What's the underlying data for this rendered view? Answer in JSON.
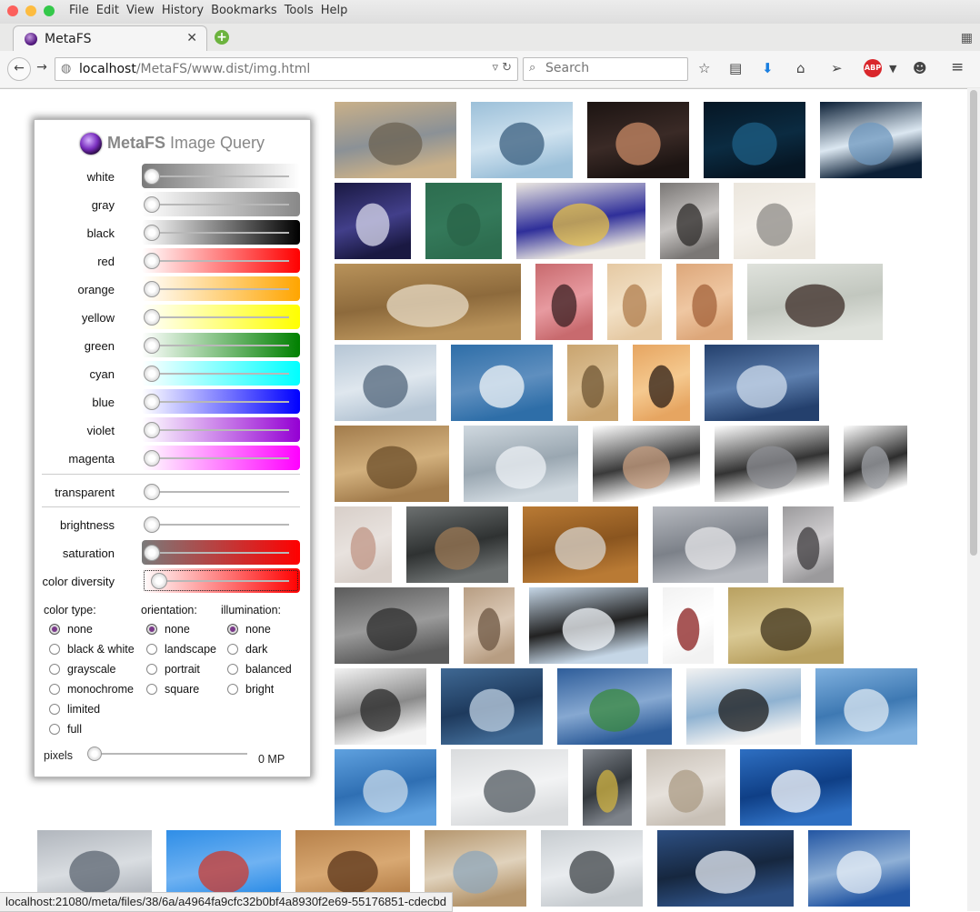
{
  "window": {
    "menu": [
      "File",
      "Edit",
      "View",
      "History",
      "Bookmarks",
      "Tools",
      "Help"
    ]
  },
  "tab": {
    "title": "MetaFS"
  },
  "url": {
    "host": "localhost",
    "path": "/MetaFS/www.dist/img.html"
  },
  "search": {
    "placeholder": "Search"
  },
  "panel": {
    "title_bold": "MetaFS",
    "title_rest": "Image Query",
    "sliders": [
      {
        "label": "white",
        "gradient": "linear-gradient(to left,#ffffff,#7a7a7a)"
      },
      {
        "label": "gray",
        "gradient": "linear-gradient(to right,#ffffff,#888888)"
      },
      {
        "label": "black",
        "gradient": "linear-gradient(to right,#ffffff,#000000)"
      },
      {
        "label": "red",
        "gradient": "linear-gradient(to right,#ffffff,#ff0000)"
      },
      {
        "label": "orange",
        "gradient": "linear-gradient(to right,#ffffff,#ffa500)"
      },
      {
        "label": "yellow",
        "gradient": "linear-gradient(to right,#ffffff,#ffff00)"
      },
      {
        "label": "green",
        "gradient": "linear-gradient(to right,#ffffff,#008000)"
      },
      {
        "label": "cyan",
        "gradient": "linear-gradient(to right,#ffffff,#00ffff)"
      },
      {
        "label": "blue",
        "gradient": "linear-gradient(to right,#ffffff,#0000ff)"
      },
      {
        "label": "violet",
        "gradient": "linear-gradient(to right,#ffffff,#9400d3)"
      },
      {
        "label": "magenta",
        "gradient": "linear-gradient(to right,#ffffff,#ff00ff)"
      }
    ],
    "transparent_label": "transparent",
    "brightness_label": "brightness",
    "saturation_label": "saturation",
    "diversity_label": "color diversity",
    "color_type": {
      "label": "color type:",
      "options": [
        "none",
        "black & white",
        "grayscale",
        "monochrome",
        "limited",
        "full"
      ],
      "selected": "none"
    },
    "orientation": {
      "label": "orientation:",
      "options": [
        "none",
        "landscape",
        "portrait",
        "square"
      ],
      "selected": "none"
    },
    "illumination": {
      "label": "illumination:",
      "options": [
        "none",
        "dark",
        "balanced",
        "bright"
      ],
      "selected": "none"
    },
    "pixels_label": "pixels",
    "pixels_value": "0 MP"
  },
  "thumbnails": [
    {
      "name": "lighthouse",
      "colors": [
        "#c9b089",
        "#6b6152",
        "#8b9196"
      ]
    },
    {
      "name": "misty-forest",
      "colors": [
        "#9cc0d9",
        "#3b5f7f",
        "#cfe2ef"
      ]
    },
    {
      "name": "woman-lingerie",
      "colors": [
        "#1c1412",
        "#c88a66",
        "#3a2a26"
      ]
    },
    {
      "name": "planet-space",
      "colors": [
        "#061624",
        "#1d5f86",
        "#0b2b41"
      ]
    },
    {
      "name": "planets-sky",
      "colors": [
        "#0b1f36",
        "#6f98bf",
        "#dbe7f1"
      ]
    },
    {
      "name": "white-flower",
      "colors": [
        "#1a1942",
        "#d9d9ec",
        "#423f8a"
      ]
    },
    {
      "name": "green-square",
      "colors": [
        "#2d6d4f",
        "#2a6448",
        "#34795a"
      ]
    },
    {
      "name": "mondrian-blocks",
      "colors": [
        "#ece8e1",
        "#e4bf47",
        "#2f2f9a"
      ]
    },
    {
      "name": "man-mustache",
      "colors": [
        "#7a7775",
        "#2e2b2a",
        "#c7c4c2"
      ]
    },
    {
      "name": "scribble-pattern",
      "colors": [
        "#ebe6dd",
        "#8d8b87",
        "#f5f1eb"
      ]
    },
    {
      "name": "golden-wallpaper",
      "colors": [
        "#b8925a",
        "#e8dcc7",
        "#8d6a3c"
      ]
    },
    {
      "name": "red-abstract",
      "colors": [
        "#c86a6e",
        "#3a1f21",
        "#e79aa0"
      ]
    },
    {
      "name": "vitruvian-man",
      "colors": [
        "#e5c9a3",
        "#b07d4e",
        "#f2e0c5"
      ]
    },
    {
      "name": "sketch-drawing",
      "colors": [
        "#dda77a",
        "#a3623a",
        "#efc7a2"
      ]
    },
    {
      "name": "woman-portrait",
      "colors": [
        "#dfe2dc",
        "#3b2b26",
        "#c2c7bf"
      ]
    },
    {
      "name": "calm-lake",
      "colors": [
        "#b6c6d5",
        "#52667b",
        "#dfe7ee"
      ]
    },
    {
      "name": "snowy-mountains",
      "colors": [
        "#2e6ea8",
        "#f2f5f8",
        "#5f8fbf"
      ]
    },
    {
      "name": "meerkat",
      "colors": [
        "#c9a46f",
        "#6f5533",
        "#dbbf93"
      ]
    },
    {
      "name": "church-silhouette",
      "colors": [
        "#e6a561",
        "#2c1d16",
        "#f5c98f"
      ]
    },
    {
      "name": "river-waves",
      "colors": [
        "#24406d",
        "#cfdcec",
        "#5d7fae"
      ]
    },
    {
      "name": "sand-texture",
      "colors": [
        "#a27c4c",
        "#6b4d2a",
        "#d2b07d"
      ]
    },
    {
      "name": "crystal-bracelet",
      "colors": [
        "#cfd8df",
        "#eef2f5",
        "#9aa7b1"
      ]
    },
    {
      "name": "stretching-man",
      "colors": [
        "#ffffff",
        "#c79d7f",
        "#3a3a3a"
      ]
    },
    {
      "name": "man-exercise-ball",
      "colors": [
        "#ffffff",
        "#8d8f94",
        "#333333"
      ]
    },
    {
      "name": "woman-exercise-ball",
      "colors": [
        "#ffffff",
        "#9da0a5",
        "#2d2d2d"
      ]
    },
    {
      "name": "mannequin",
      "colors": [
        "#d8cfc9",
        "#c09685",
        "#e8e2de"
      ]
    },
    {
      "name": "conference-room",
      "colors": [
        "#6c7070",
        "#9c7a55",
        "#2f3232"
      ]
    },
    {
      "name": "blank-cards",
      "colors": [
        "#b97a34",
        "#d8d4cd",
        "#8a551f"
      ]
    },
    {
      "name": "airliner-emirates",
      "colors": [
        "#b6b9bf",
        "#e7e7e9",
        "#7c8189"
      ]
    },
    {
      "name": "desert-dunes",
      "colors": [
        "#9b9a9c",
        "#3d3b3d",
        "#d2d0d2"
      ]
    },
    {
      "name": "rhinoceros",
      "colors": [
        "#5b5b5b",
        "#2c2c2c",
        "#9a9a9a"
      ]
    },
    {
      "name": "girl-sepia",
      "colors": [
        "#b79d82",
        "#6c5542",
        "#dccab7"
      ]
    },
    {
      "name": "bird-sky",
      "colors": [
        "#c5d6e6",
        "#f2f6fa",
        "#222222"
      ]
    },
    {
      "name": "wine-glass",
      "colors": [
        "#f2f2f2",
        "#8a1e1e",
        "#ffffff"
      ]
    },
    {
      "name": "windmill",
      "colors": [
        "#b9a161",
        "#3f331c",
        "#d9c893"
      ]
    },
    {
      "name": "tractors-snow",
      "colors": [
        "#f3f3f3",
        "#2a2a2a",
        "#8a8a8a"
      ]
    },
    {
      "name": "cloudy-sky-plane",
      "colors": [
        "#3f6893",
        "#c0d1e3",
        "#1e3a5d"
      ]
    },
    {
      "name": "green-field",
      "colors": [
        "#2e5d9a",
        "#3a8a3e",
        "#86a8d1"
      ]
    },
    {
      "name": "plane-cockpit",
      "colors": [
        "#f2f2f2",
        "#1a1a1a",
        "#8fb2d1"
      ]
    },
    {
      "name": "airbus-sky",
      "colors": [
        "#7fb0de",
        "#dfe9f3",
        "#3e79b3"
      ]
    },
    {
      "name": "airbus-flying",
      "colors": [
        "#5fa1df",
        "#c8d9ea",
        "#2f6fb3"
      ]
    },
    {
      "name": "jet-carrier",
      "colors": [
        "#d9dbdd",
        "#525a60",
        "#f2f3f4"
      ]
    },
    {
      "name": "carrier-crew",
      "colors": [
        "#7d8289",
        "#d2b443",
        "#33383d"
      ]
    },
    {
      "name": "cargo-plane",
      "colors": [
        "#c8c0b6",
        "#ab9b84",
        "#e6e1db"
      ]
    },
    {
      "name": "business-jet",
      "colors": [
        "#2e6fc2",
        "#ffffff",
        "#0f3f86"
      ]
    },
    {
      "name": "airport-tower",
      "colors": [
        "#b1b6bd",
        "#5b6470",
        "#d9dde1"
      ]
    },
    {
      "name": "biplane",
      "colors": [
        "#2f8ee7",
        "#cf3a2c",
        "#6fb2f2"
      ]
    },
    {
      "name": "arabesque-pattern",
      "colors": [
        "#b7814a",
        "#5a3419",
        "#d8a872"
      ]
    },
    {
      "name": "beach-waves",
      "colors": [
        "#b4956c",
        "#8da5ba",
        "#e0d2bc"
      ]
    },
    {
      "name": "rocky-coast",
      "colors": [
        "#c7ccd0",
        "#3f4448",
        "#e9ecef"
      ]
    },
    {
      "name": "snowy-tree",
      "colors": [
        "#2d4f82",
        "#e8eef5",
        "#16273f"
      ]
    },
    {
      "name": "snow-field",
      "colors": [
        "#2356a3",
        "#e9f0f7",
        "#8fb0d6"
      ]
    }
  ],
  "status_url": "localhost:21080/meta/files/38/6a/a4964fa9cfc32b0bf4a8930f2e69-55176851-cdecbd"
}
